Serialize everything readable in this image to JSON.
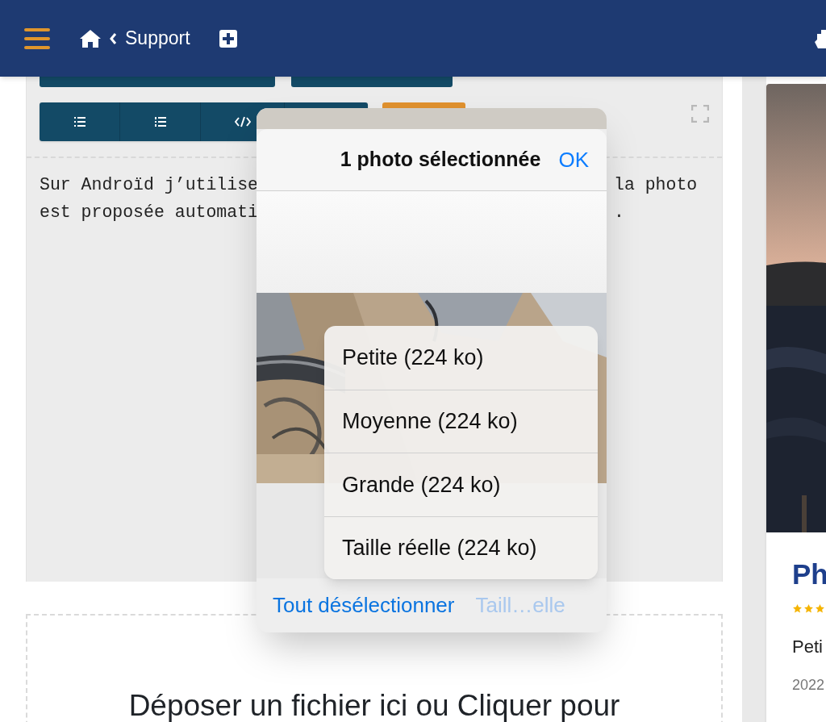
{
  "header": {
    "back_label": "Support"
  },
  "editor": {
    "lines": [
      {
        "left": "Sur Androïd j’utilise",
        "right": "la photo"
      },
      {
        "left": "est proposée automati",
        "right": "."
      }
    ]
  },
  "dropzone": {
    "text": "Déposer un fichier ici ou Cliquer pour"
  },
  "card": {
    "title": "Ph",
    "stars": 3,
    "text": "Peti",
    "date": "2022"
  },
  "picker": {
    "title": "1 photo sélectionnée",
    "ok": "OK",
    "sizes": [
      "Petite (224 ko)",
      "Moyenne (224 ko)",
      "Grande (224 ko)",
      "Taille réelle (224 ko)"
    ],
    "deselect": "Tout désélectionner",
    "size_button": {
      "label": "Taill…elle",
      "disabled": true
    }
  }
}
